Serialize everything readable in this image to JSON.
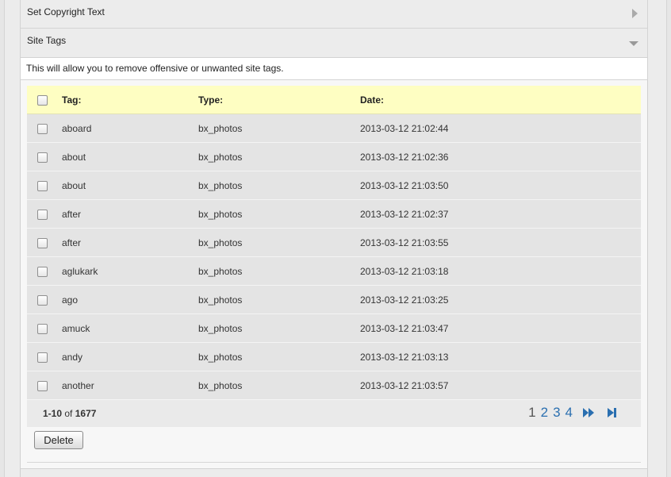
{
  "sections": {
    "copyright": {
      "label": "Set Copyright Text"
    },
    "site_tags": {
      "label": "Site Tags",
      "description": "This will allow you to remove offensive or unwanted site tags."
    }
  },
  "table": {
    "headers": {
      "tag": "Tag:",
      "type": "Type:",
      "date": "Date:"
    },
    "rows": [
      {
        "tag": "aboard",
        "type": "bx_photos",
        "date": "2013-03-12 21:02:44"
      },
      {
        "tag": "about",
        "type": "bx_photos",
        "date": "2013-03-12 21:02:36"
      },
      {
        "tag": "about",
        "type": "bx_photos",
        "date": "2013-03-12 21:03:50"
      },
      {
        "tag": "after",
        "type": "bx_photos",
        "date": "2013-03-12 21:02:37"
      },
      {
        "tag": "after",
        "type": "bx_photos",
        "date": "2013-03-12 21:03:55"
      },
      {
        "tag": "aglukark",
        "type": "bx_photos",
        "date": "2013-03-12 21:03:18"
      },
      {
        "tag": "ago",
        "type": "bx_photos",
        "date": "2013-03-12 21:03:25"
      },
      {
        "tag": "amuck",
        "type": "bx_photos",
        "date": "2013-03-12 21:03:47"
      },
      {
        "tag": "andy",
        "type": "bx_photos",
        "date": "2013-03-12 21:03:13"
      },
      {
        "tag": "another",
        "type": "bx_photos",
        "date": "2013-03-12 21:03:57"
      }
    ]
  },
  "pagination": {
    "range": "1-10",
    "of_label": "of",
    "total": "1677",
    "pages": [
      "1",
      "2",
      "3",
      "4"
    ],
    "current_page": "1",
    "next_icon": "fast-forward-icon",
    "last_icon": "skip-to-last-icon",
    "link_color": "#2a6fb0"
  },
  "actions": {
    "delete_label": "Delete"
  },
  "colors": {
    "header_row": "#fefec2",
    "row": "#e4e4e4"
  }
}
